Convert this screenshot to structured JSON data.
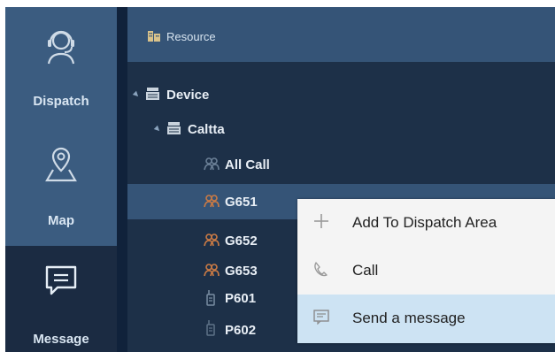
{
  "nav": {
    "items": [
      {
        "label": "Dispatch",
        "icon": "headset-icon"
      },
      {
        "label": "Map",
        "icon": "map-pin-icon"
      },
      {
        "label": "Message",
        "icon": "chat-message-icon"
      }
    ]
  },
  "panel": {
    "title": "Resource",
    "title_icon": "building-icon"
  },
  "tree": {
    "device": "Device",
    "organization": "Caltta",
    "all_call": "All Call",
    "groups": [
      "G651",
      "G652",
      "G653"
    ],
    "terminals": [
      "P601",
      "P602"
    ]
  },
  "context_menu": {
    "items": [
      {
        "label": "Add To Dispatch Area",
        "icon": "plus-icon"
      },
      {
        "label": "Call",
        "icon": "phone-icon"
      },
      {
        "label": "Send a message",
        "icon": "message-icon"
      }
    ]
  },
  "colors": {
    "nav_bg": "#1f3654",
    "nav_active": "#3b5c80",
    "panel_bg": "#1d3048",
    "header_bg": "#355477",
    "menu_bg": "#f4f4f4",
    "menu_hover": "#cde3f3",
    "group_icon": "#c97a45"
  }
}
